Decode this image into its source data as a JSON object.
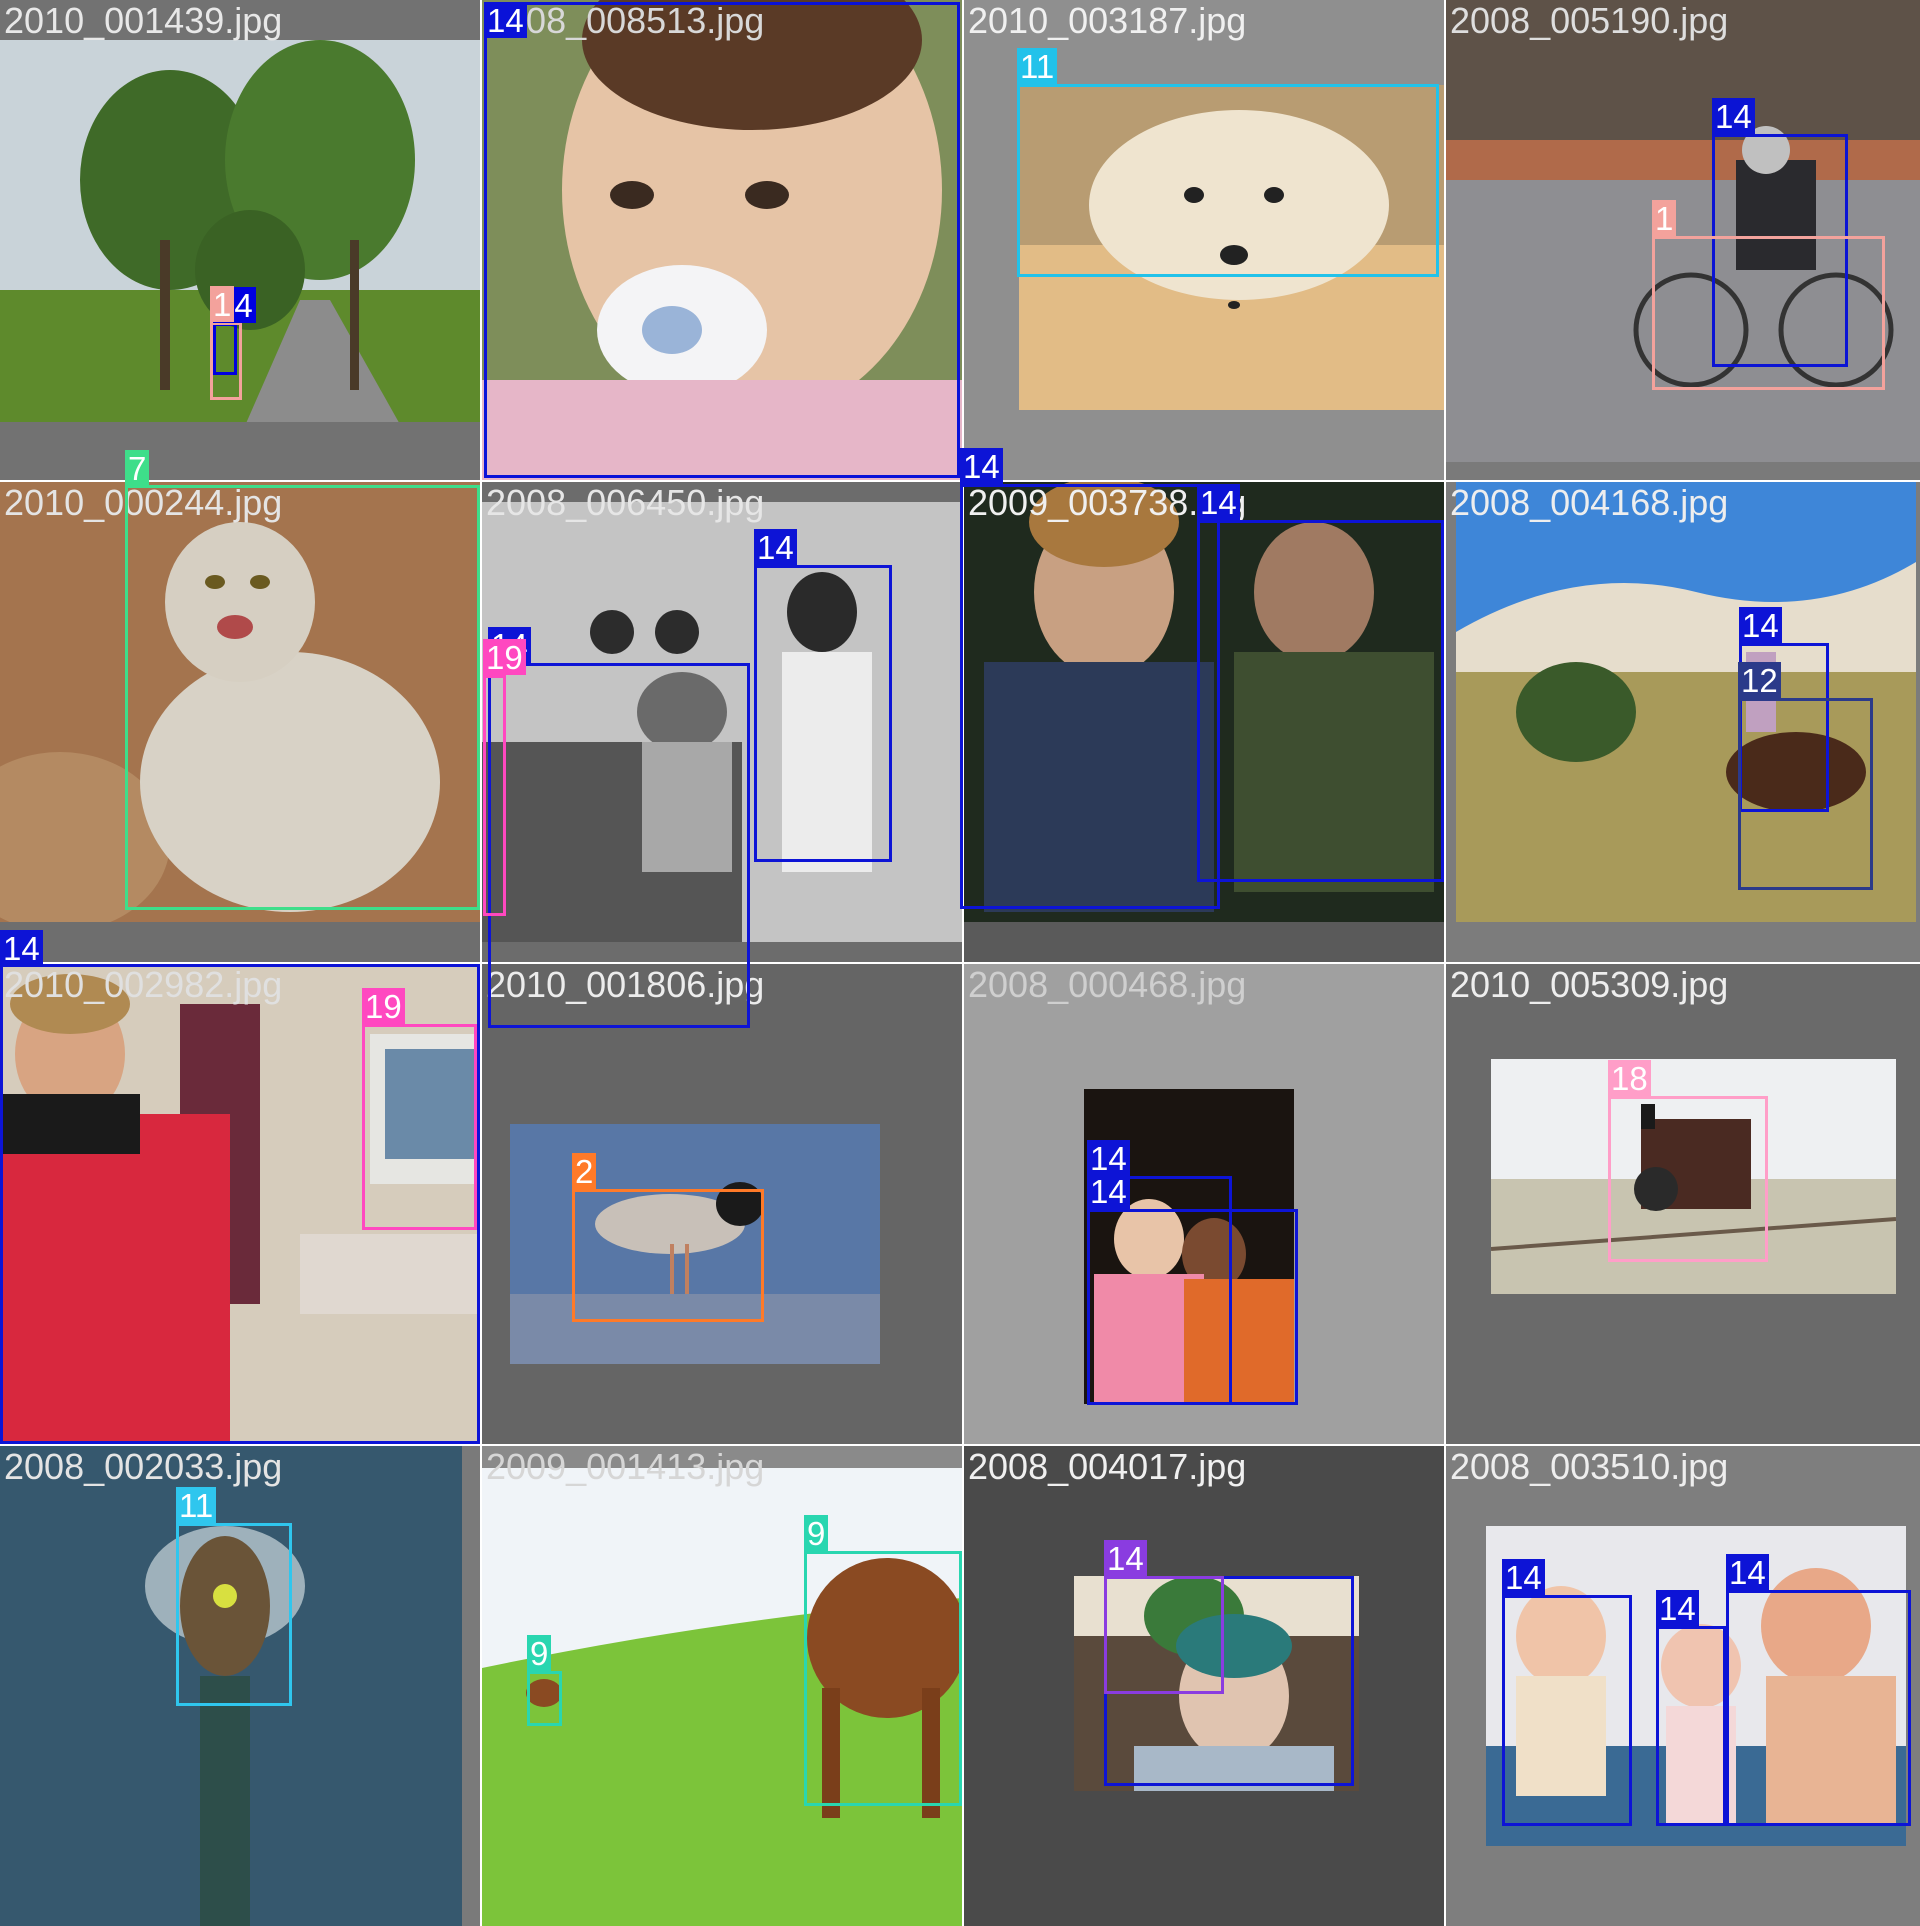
{
  "mosaic": {
    "tiles": [
      {
        "filename": "2010_001439.jpg",
        "filename_color": "#e8e8e8",
        "tile_bg": "#727272",
        "image_bg": "#8a9e6a",
        "boxes": [
          {
            "class_id": "14",
            "color": "#0000e0"
          },
          {
            "class_id": "1",
            "color": "#f3a29c"
          }
        ]
      },
      {
        "filename": "2008_008513.jpg",
        "filename_color": "#d8d8d8",
        "tile_bg": "#8e7e6c",
        "image_bg": "#cdb9a2",
        "boxes": [
          {
            "class_id": "14",
            "color": "#0a12d8"
          }
        ]
      },
      {
        "filename": "2010_003187.jpg",
        "filename_color": "#f0f0f0",
        "tile_bg": "#8f8f8f",
        "image_bg": "#d6b07a",
        "boxes": [
          {
            "class_id": "11",
            "color": "#22c2ea"
          }
        ]
      },
      {
        "filename": "2008_005190.jpg",
        "filename_color": "#dedede",
        "tile_bg": "#7a7a7a",
        "image_bg": "#9a9a9f",
        "boxes": [
          {
            "class_id": "14",
            "color": "#0b14d4"
          },
          {
            "class_id": "1",
            "color": "#f3a29c"
          }
        ]
      },
      {
        "filename": "2010_000244.jpg",
        "filename_color": "#e4e4e4",
        "tile_bg": "#6e6e6e",
        "image_bg": "#9a6e4a",
        "boxes": [
          {
            "class_id": "7",
            "color": "#3ede8a"
          }
        ]
      },
      {
        "filename": "2008_006450.jpg",
        "filename_color": "#e6e6e6",
        "tile_bg": "#6c6c6c",
        "image_bg": "#b9b9b9",
        "boxes": [
          {
            "class_id": "14",
            "color": "#0d14d6"
          },
          {
            "class_id": "14",
            "color": "#0d14d6"
          },
          {
            "class_id": "19",
            "color": "#ff48c0"
          }
        ]
      },
      {
        "filename": "2009_003738.jpg",
        "filename_color": "#f0f0f0",
        "tile_bg": "#5a5a5a",
        "image_bg": "#2d3a28",
        "boxes": [
          {
            "class_id": "14",
            "color": "#0d14d6"
          },
          {
            "class_id": "14",
            "color": "#0d14d6"
          }
        ]
      },
      {
        "filename": "2008_004168.jpg",
        "filename_color": "#eeeeee",
        "tile_bg": "#7c7c7c",
        "image_bg": "#8aa15a",
        "boxes": [
          {
            "class_id": "14",
            "color": "#0d14d6"
          },
          {
            "class_id": "12",
            "color": "#2b3a8a"
          }
        ]
      },
      {
        "filename": "2010_002982.jpg",
        "filename_color": "#e0e0e0",
        "tile_bg": "#7a7a7a",
        "image_bg": "#c8b9a8",
        "boxes": [
          {
            "class_id": "14",
            "color": "#0d14d6"
          },
          {
            "class_id": "19",
            "color": "#ff48c0"
          }
        ]
      },
      {
        "filename": "2010_001806.jpg",
        "filename_color": "#ececec",
        "tile_bg": "#656565",
        "image_bg": "#5a7aa8",
        "boxes": [
          {
            "class_id": "2",
            "color": "#ff7a28"
          }
        ]
      },
      {
        "filename": "2008_000468.jpg",
        "filename_color": "#cfcfcf",
        "tile_bg": "#a0a0a0",
        "image_bg": "#1a1410",
        "boxes": [
          {
            "class_id": "14",
            "color": "#0d14d6"
          },
          {
            "class_id": "14",
            "color": "#0d14d6"
          }
        ]
      },
      {
        "filename": "2010_005309.jpg",
        "filename_color": "#eeeeee",
        "tile_bg": "#6a6a6a",
        "image_bg": "#eef0f0",
        "boxes": [
          {
            "class_id": "18",
            "color": "#ff9ec8"
          }
        ]
      },
      {
        "filename": "2008_002033.jpg",
        "filename_color": "#e4e4e4",
        "tile_bg": "#7a7a7a",
        "image_bg": "#3c5f7a",
        "boxes": [
          {
            "class_id": "11",
            "color": "#2fc6ee"
          }
        ]
      },
      {
        "filename": "2009_001413.jpg",
        "filename_color": "#d6d6d6",
        "tile_bg": "#8a8a8a",
        "image_bg": "#e4ecf4",
        "boxes": [
          {
            "class_id": "9",
            "color": "#29d6b0"
          },
          {
            "class_id": "9",
            "color": "#29d6b0"
          }
        ]
      },
      {
        "filename": "2008_004017.jpg",
        "filename_color": "#f0f0f0",
        "tile_bg": "#4a4a4a",
        "image_bg": "#6a5a4a",
        "boxes": [
          {
            "class_id": "14",
            "color": "#0d14d6"
          },
          {
            "class_id": "14",
            "color": "#8a3ce0"
          }
        ]
      },
      {
        "filename": "2008_003510.jpg",
        "filename_color": "#eeeeee",
        "tile_bg": "#7e7e7e",
        "image_bg": "#3c6c96",
        "boxes": [
          {
            "class_id": "14",
            "color": "#0d14d6"
          },
          {
            "class_id": "14",
            "color": "#0d14d6"
          },
          {
            "class_id": "14",
            "color": "#0d14d6"
          }
        ]
      }
    ]
  }
}
